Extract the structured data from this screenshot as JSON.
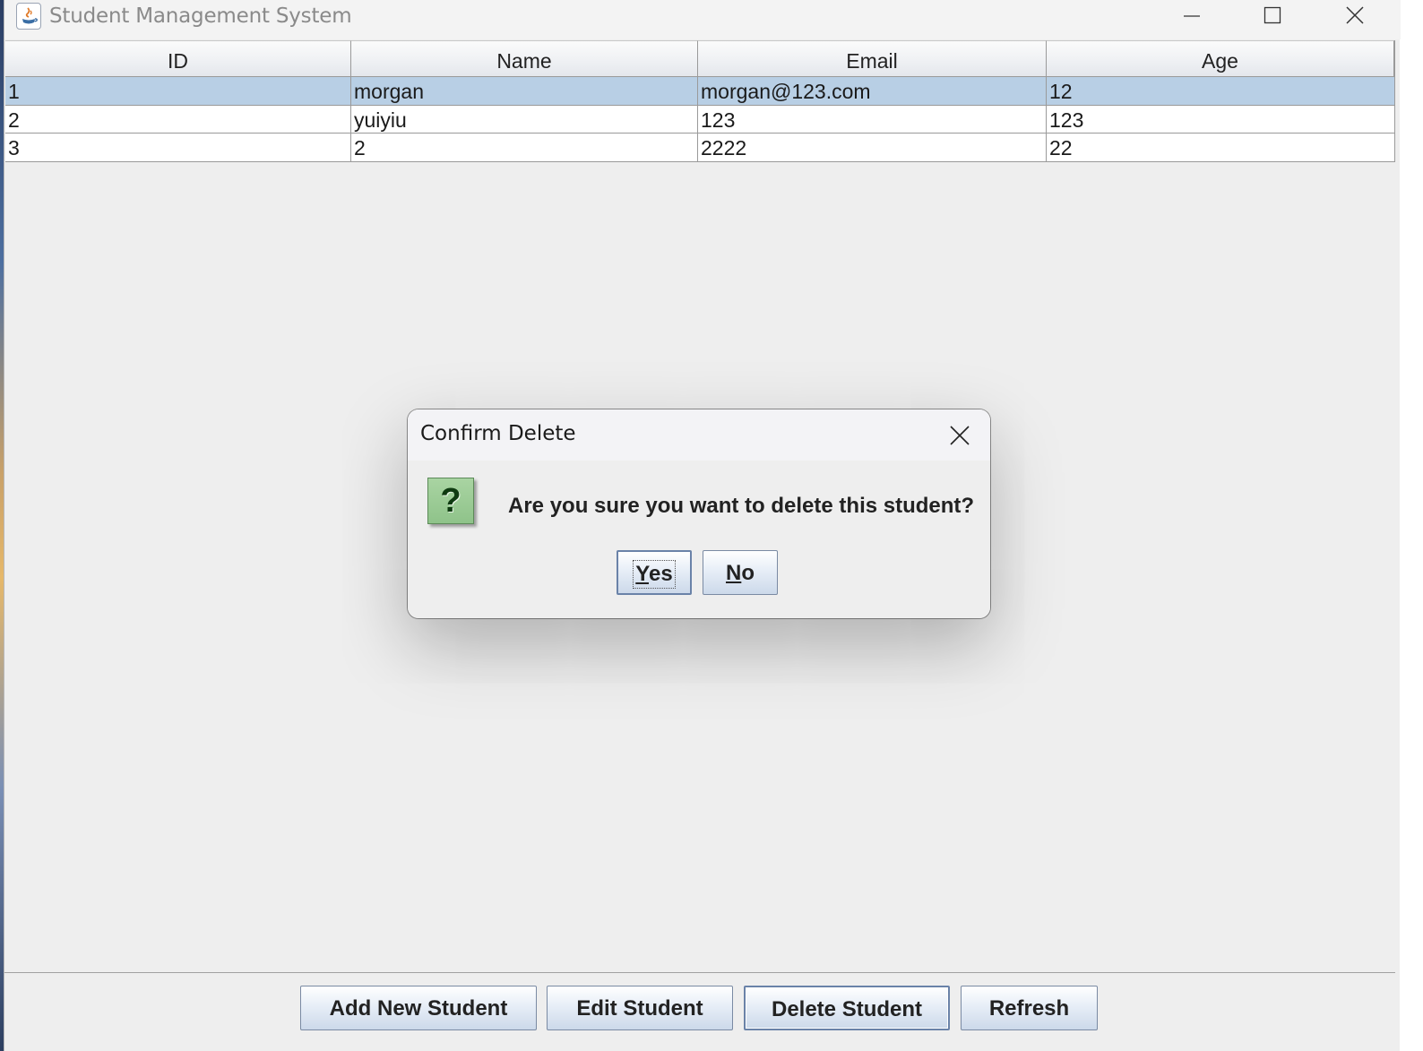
{
  "window": {
    "title": "Student Management System"
  },
  "table": {
    "columns": [
      "ID",
      "Name",
      "Email",
      "Age"
    ],
    "rows": [
      {
        "id": "1",
        "name": "morgan",
        "email": "morgan@123.com",
        "age": "12",
        "selected": true
      },
      {
        "id": "2",
        "name": "yuiyiu",
        "email": "123",
        "age": "123",
        "selected": false
      },
      {
        "id": "3",
        "name": "2",
        "email": "2222",
        "age": "22",
        "selected": false
      }
    ]
  },
  "toolbar": {
    "add_label": "Add New Student",
    "edit_label": "Edit Student",
    "delete_label": "Delete Student",
    "refresh_label": "Refresh"
  },
  "dialog": {
    "title": "Confirm Delete",
    "icon": "question-icon",
    "icon_glyph": "?",
    "message": "Are you sure you want to delete this student?",
    "yes_mnemonic": "Y",
    "yes_rest": "es",
    "no_mnemonic": "N",
    "no_rest": "o"
  },
  "colors": {
    "selection": "#b8cfe5",
    "icon_green": "#8fc38a"
  }
}
